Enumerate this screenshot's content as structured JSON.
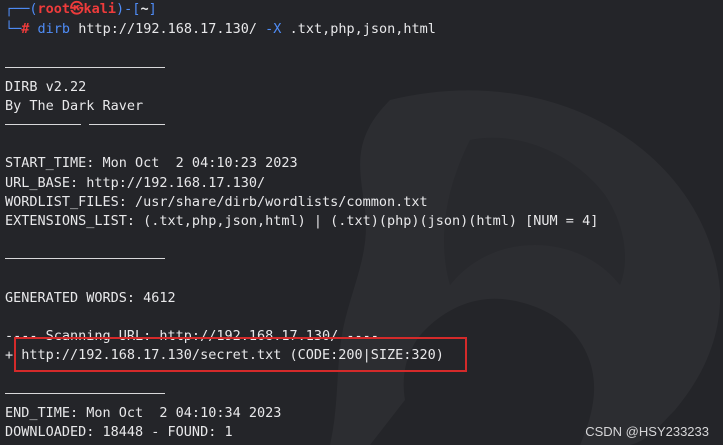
{
  "prompt": {
    "open": "┌──(",
    "user": "root",
    "skull": "㉿",
    "host": "kali",
    "mid": ")-[",
    "dir": "~",
    "close": "]",
    "corner": "└─",
    "hash": "#",
    "command": "dirb",
    "url_arg": "http://192.168.17.130/",
    "flag": "-X",
    "ext_arg": ".txt,php,json,html"
  },
  "banner": {
    "name": "DIRB v2.22",
    "author": "By The Dark Raver"
  },
  "info": {
    "start_time": "START_TIME: Mon Oct  2 04:10:23 2023",
    "url_base": "URL_BASE: http://192.168.17.130/",
    "wordlist": "WORDLIST_FILES: /usr/share/dirb/wordlists/common.txt",
    "extensions": "EXTENSIONS_LIST: (.txt,php,json,html) | (.txt)(php)(json)(html) [NUM = 4]"
  },
  "generated": "GENERATED WORDS: 4612",
  "scanning": "---- Scanning URL: http://192.168.17.130/ ----",
  "result": "+ http://192.168.17.130/secret.txt (CODE:200|SIZE:320)",
  "end": {
    "end_time": "END_TIME: Mon Oct  2 04:10:34 2023",
    "downloaded": "DOWNLOADED: 18448 - FOUND: 1"
  },
  "watermark": "CSDN @HSY233233",
  "colors": {
    "background": "#242529",
    "prompt_blue": "#4f8cf6",
    "prompt_red": "#ee3b3b",
    "highlight_box": "#d42a2a"
  }
}
